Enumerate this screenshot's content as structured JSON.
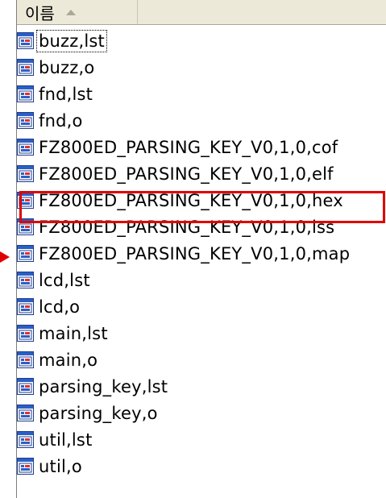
{
  "header": {
    "name_label": "이름"
  },
  "files": [
    "buzz,lst",
    "buzz,o",
    "fnd,lst",
    "fnd,o",
    "FZ800ED_PARSING_KEY_V0,1,0,cof",
    "FZ800ED_PARSING_KEY_V0,1,0,elf",
    "FZ800ED_PARSING_KEY_V0,1,0,hex",
    "FZ800ED_PARSING_KEY_V0,1,0,lss",
    "FZ800ED_PARSING_KEY_V0,1,0,map",
    "lcd,lst",
    "lcd,o",
    "main,lst",
    "main,o",
    "parsing_key,lst",
    "parsing_key,o",
    "util,lst",
    "util,o"
  ],
  "focused_index": 0,
  "highlighted_index": 6,
  "colors": {
    "highlight": "#e00000",
    "header_bg": "#ece9d8"
  },
  "icon": "file-document-icon"
}
